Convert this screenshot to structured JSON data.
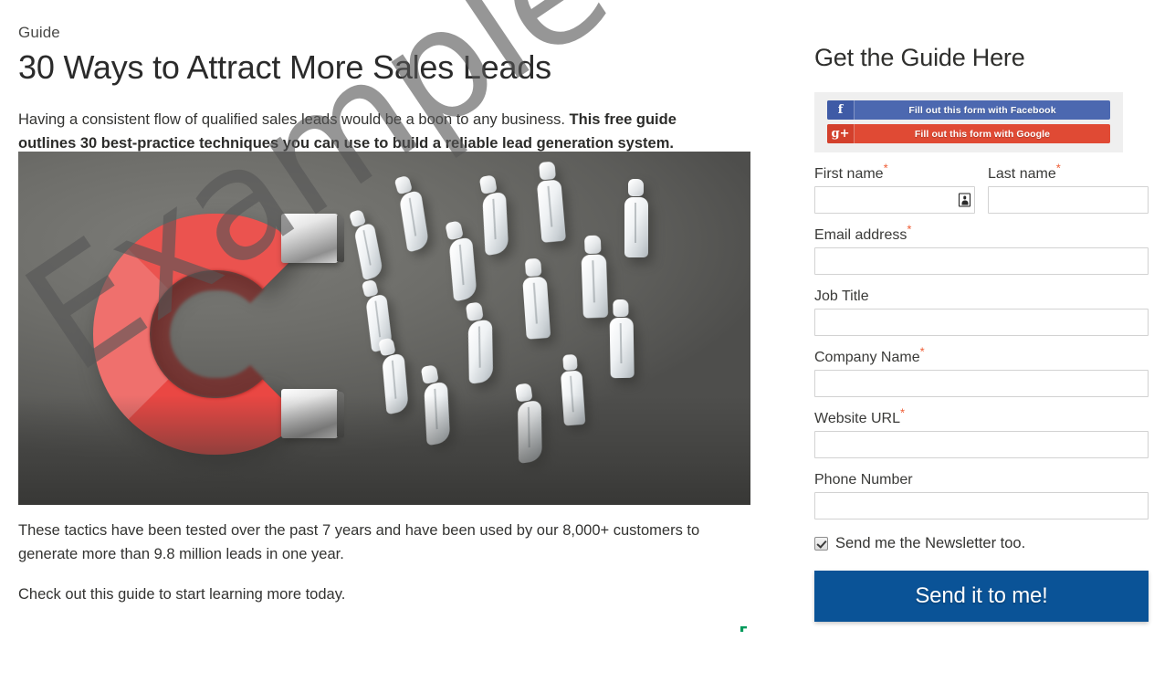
{
  "left": {
    "eyebrow": "Guide",
    "headline": "30 Ways to Attract More Sales Leads",
    "intro_plain": "Having a consistent flow of qualified sales leads would be a boon to any business. ",
    "intro_bold": "This free guide outlines 30 best-practice techniques you can use to build a reliable lead generation system.",
    "hero_image_alt": "red horseshoe magnet attracting white 3d human figures",
    "body_paragraph_1": "These tactics have been tested over the past 7 years and have been used by our 8,000+ customers to generate more than 9.8 million leads in one year.",
    "body_paragraph_2": "Check out this guide to start learning more today."
  },
  "watermark": {
    "text": "Example"
  },
  "form": {
    "title": "Get the Guide Here",
    "social": {
      "facebook": {
        "icon": "f",
        "label": "Fill out this form with Facebook",
        "color": "#4c68b0"
      },
      "google": {
        "icon": "g+",
        "label": "Fill out this form with Google",
        "color": "#e04a34"
      }
    },
    "fields": [
      {
        "label": "First name",
        "required": true,
        "value": "",
        "placeholder": ""
      },
      {
        "label": "Last name",
        "required": true,
        "value": "",
        "placeholder": ""
      },
      {
        "label": "Email address",
        "required": true,
        "value": "",
        "placeholder": ""
      },
      {
        "label": "Job Title",
        "required": false,
        "value": "",
        "placeholder": ""
      },
      {
        "label": "Company Name",
        "required": true,
        "value": "",
        "placeholder": ""
      },
      {
        "label": "Website URL",
        "required": true,
        "value": "",
        "placeholder": ""
      },
      {
        "label": "Phone Number",
        "required": false,
        "value": "",
        "placeholder": ""
      }
    ],
    "required_marker": "*",
    "newsletter": {
      "label": "Send me the Newsletter too.",
      "checked": true
    },
    "submit_label": "Send it to me!",
    "submit_color": "#0a5397"
  }
}
